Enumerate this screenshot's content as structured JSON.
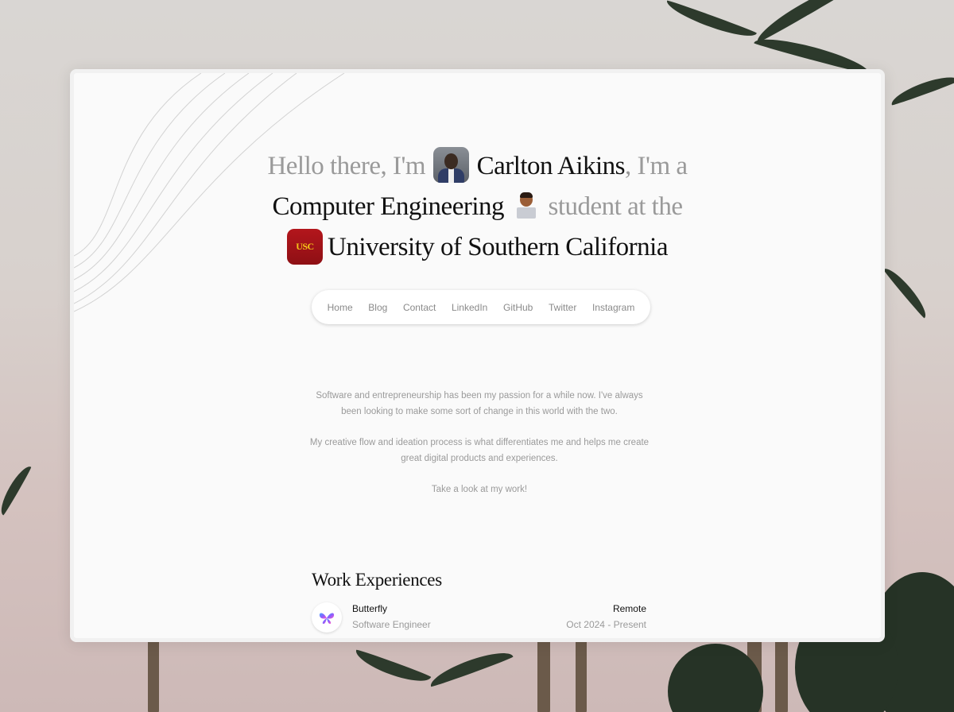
{
  "hero": {
    "intro": "Hello there, I'm",
    "name": "Carlton Aikins",
    "im_a": ", I'm a",
    "field": "Computer Engineering",
    "student_at": "student at the",
    "school_logo_text": "USC",
    "school": "University of Southern California"
  },
  "nav": {
    "items": [
      "Home",
      "Blog",
      "Contact",
      "LinkedIn",
      "GitHub",
      "Twitter",
      "Instagram"
    ]
  },
  "about": {
    "p1": "Software and entrepreneurship has been my passion for a while now. I've always been looking to make some sort of change in this world with the two.",
    "p2": "My creative flow and ideation process is what differentiates me and helps me create great digital products and experiences.",
    "p3": "Take a look at my work!"
  },
  "work": {
    "title": "Work Experiences",
    "jobs": [
      {
        "company": "Butterfly",
        "role": "Software Engineer",
        "location": "Remote",
        "dates": "Oct 2024 - Present",
        "icon": "butterfly-icon"
      }
    ]
  },
  "colors": {
    "text": "#111111",
    "muted": "#9a9a9a",
    "usc_red": "#990000",
    "usc_gold": "#FFCC00"
  }
}
